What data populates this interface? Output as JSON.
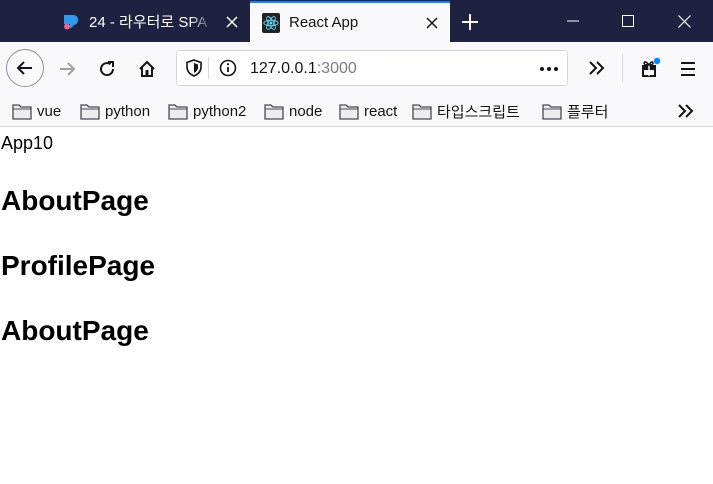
{
  "tabs": [
    {
      "title": "24 - 라우터로 SPA"
    },
    {
      "title": "React App"
    }
  ],
  "address_bar": {
    "host": "127.0.0.1",
    "port": ":3000"
  },
  "bookmarks": [
    {
      "label": "vue"
    },
    {
      "label": "python"
    },
    {
      "label": "python2"
    },
    {
      "label": "node"
    },
    {
      "label": "react"
    },
    {
      "label": "타입스크립트"
    },
    {
      "label": "플루터"
    }
  ],
  "page": {
    "app_label": "App10",
    "headings": [
      "AboutPage",
      "ProfilePage",
      "AboutPage"
    ]
  },
  "colors": {
    "titlebar": "#1f2140",
    "active_tab_accent": "#0a84ff",
    "toolbar": "#f9f9fb",
    "react_logo": "#61dafb",
    "notification_dot": "#0a84ff"
  },
  "icons": {
    "back": "back-arrow-icon",
    "forward": "forward-arrow-icon",
    "reload": "reload-icon",
    "home": "home-icon",
    "shield": "shield-icon",
    "info": "info-icon",
    "more": "more-dots-icon",
    "overflow": "double-chevron-icon",
    "extensions": "gift-icon",
    "menu": "hamburger-menu-icon",
    "folder": "folder-icon"
  }
}
